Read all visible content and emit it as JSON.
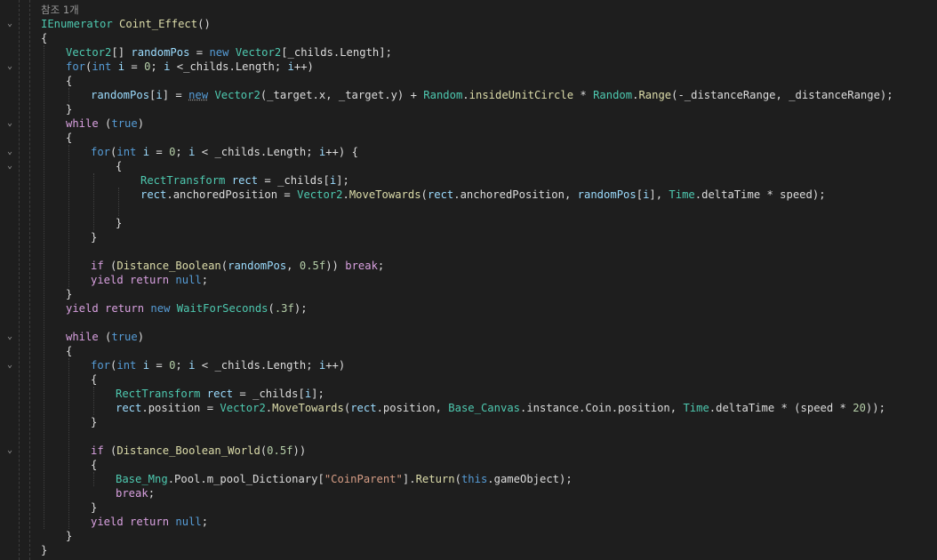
{
  "editor": {
    "codelens": "참조 1개",
    "lines": [
      [
        [
          "t",
          "IEnumerator"
        ],
        [
          "m",
          " Coint_Effect"
        ],
        [
          "p",
          "()"
        ]
      ],
      [
        [
          "p",
          "{"
        ]
      ],
      [
        [
          "t",
          "Vector2"
        ],
        [
          "p",
          "[] "
        ],
        [
          "v",
          "randomPos"
        ],
        [
          "p",
          " = "
        ],
        [
          "k",
          "new"
        ],
        [
          "p",
          " "
        ],
        [
          "t",
          "Vector2"
        ],
        [
          "p",
          "[_childs.Length];"
        ]
      ],
      [
        [
          "k",
          "for"
        ],
        [
          "p",
          "("
        ],
        [
          "k",
          "int"
        ],
        [
          "p",
          " "
        ],
        [
          "v",
          "i"
        ],
        [
          "p",
          " = "
        ],
        [
          "n",
          "0"
        ],
        [
          "p",
          "; "
        ],
        [
          "v",
          "i"
        ],
        [
          "p",
          " <_childs.Length; "
        ],
        [
          "v",
          "i"
        ],
        [
          "p",
          "++)"
        ]
      ],
      [
        [
          "p",
          "{"
        ]
      ],
      [
        [
          "v",
          "randomPos"
        ],
        [
          "p",
          "["
        ],
        [
          "v",
          "i"
        ],
        [
          "p",
          "] = "
        ],
        [
          "kq",
          "new"
        ],
        [
          "p",
          " "
        ],
        [
          "t",
          "Vector2"
        ],
        [
          "p",
          "(_target.x, _target.y) + "
        ],
        [
          "t",
          "Random"
        ],
        [
          "p",
          "."
        ],
        [
          "m",
          "insideUnitCircle"
        ],
        [
          "p",
          " * "
        ],
        [
          "t",
          "Random"
        ],
        [
          "p",
          "."
        ],
        [
          "m",
          "Range"
        ],
        [
          "p",
          "(-_distanceRange, _distanceRange);"
        ]
      ],
      [
        [
          "p",
          "}"
        ]
      ],
      [
        [
          "c",
          "while"
        ],
        [
          "p",
          " ("
        ],
        [
          "k",
          "true"
        ],
        [
          "p",
          ")"
        ]
      ],
      [
        [
          "p",
          "{"
        ]
      ],
      [
        [
          "k",
          "for"
        ],
        [
          "p",
          "("
        ],
        [
          "k",
          "int"
        ],
        [
          "p",
          " "
        ],
        [
          "v",
          "i"
        ],
        [
          "p",
          " = "
        ],
        [
          "n",
          "0"
        ],
        [
          "p",
          "; "
        ],
        [
          "v",
          "i"
        ],
        [
          "p",
          " < _childs.Length; "
        ],
        [
          "v",
          "i"
        ],
        [
          "p",
          "++) {"
        ]
      ],
      [
        [
          "p",
          "{"
        ]
      ],
      [
        [
          "t",
          "RectTransform"
        ],
        [
          "p",
          " "
        ],
        [
          "v",
          "rect"
        ],
        [
          "p",
          " = _childs["
        ],
        [
          "v",
          "i"
        ],
        [
          "p",
          "];"
        ]
      ],
      [
        [
          "v",
          "rect"
        ],
        [
          "p",
          ".anchoredPosition = "
        ],
        [
          "t",
          "Vector2"
        ],
        [
          "p",
          "."
        ],
        [
          "m",
          "MoveTowards"
        ],
        [
          "p",
          "("
        ],
        [
          "v",
          "rect"
        ],
        [
          "p",
          ".anchoredPosition, "
        ],
        [
          "v",
          "randomPos"
        ],
        [
          "p",
          "["
        ],
        [
          "v",
          "i"
        ],
        [
          "p",
          "], "
        ],
        [
          "t",
          "Time"
        ],
        [
          "p",
          ".deltaTime * speed);"
        ]
      ],
      [],
      [
        [
          "p",
          "}"
        ]
      ],
      [
        [
          "p",
          "}"
        ]
      ],
      [],
      [
        [
          "c",
          "if"
        ],
        [
          "p",
          " ("
        ],
        [
          "m",
          "Distance_Boolean"
        ],
        [
          "p",
          "("
        ],
        [
          "v",
          "randomPos"
        ],
        [
          "p",
          ", "
        ],
        [
          "n",
          "0.5f"
        ],
        [
          "p",
          ")) "
        ],
        [
          "c",
          "break"
        ],
        [
          "p",
          ";"
        ]
      ],
      [
        [
          "c",
          "yield"
        ],
        [
          "p",
          " "
        ],
        [
          "c",
          "return"
        ],
        [
          "p",
          " "
        ],
        [
          "k",
          "null"
        ],
        [
          "p",
          ";"
        ]
      ],
      [
        [
          "p",
          "}"
        ]
      ],
      [
        [
          "c",
          "yield"
        ],
        [
          "p",
          " "
        ],
        [
          "c",
          "return"
        ],
        [
          "p",
          " "
        ],
        [
          "k",
          "new"
        ],
        [
          "p",
          " "
        ],
        [
          "t",
          "WaitForSeconds"
        ],
        [
          "p",
          "("
        ],
        [
          "n",
          ".3f"
        ],
        [
          "p",
          ");"
        ]
      ],
      [],
      [
        [
          "c",
          "while"
        ],
        [
          "p",
          " ("
        ],
        [
          "k",
          "true"
        ],
        [
          "p",
          ")"
        ]
      ],
      [
        [
          "p",
          "{"
        ]
      ],
      [
        [
          "k",
          "for"
        ],
        [
          "p",
          "("
        ],
        [
          "k",
          "int"
        ],
        [
          "p",
          " "
        ],
        [
          "v",
          "i"
        ],
        [
          "p",
          " = "
        ],
        [
          "n",
          "0"
        ],
        [
          "p",
          "; "
        ],
        [
          "v",
          "i"
        ],
        [
          "p",
          " < _childs.Length; "
        ],
        [
          "v",
          "i"
        ],
        [
          "p",
          "++)"
        ]
      ],
      [
        [
          "p",
          "{"
        ]
      ],
      [
        [
          "t",
          "RectTransform"
        ],
        [
          "p",
          " "
        ],
        [
          "v",
          "rect"
        ],
        [
          "p",
          " = _childs["
        ],
        [
          "v",
          "i"
        ],
        [
          "p",
          "];"
        ]
      ],
      [
        [
          "v",
          "rect"
        ],
        [
          "p",
          ".position = "
        ],
        [
          "t",
          "Vector2"
        ],
        [
          "p",
          "."
        ],
        [
          "m",
          "MoveTowards"
        ],
        [
          "p",
          "("
        ],
        [
          "v",
          "rect"
        ],
        [
          "p",
          ".position, "
        ],
        [
          "t",
          "Base_Canvas"
        ],
        [
          "p",
          ".instance.Coin.position, "
        ],
        [
          "t",
          "Time"
        ],
        [
          "p",
          ".deltaTime * (speed * "
        ],
        [
          "n",
          "20"
        ],
        [
          "p",
          "));"
        ]
      ],
      [
        [
          "p",
          "}"
        ]
      ],
      [],
      [
        [
          "c",
          "if"
        ],
        [
          "p",
          " ("
        ],
        [
          "m",
          "Distance_Boolean_World"
        ],
        [
          "p",
          "("
        ],
        [
          "n",
          "0.5f"
        ],
        [
          "p",
          "))"
        ]
      ],
      [
        [
          "p",
          "{"
        ]
      ],
      [
        [
          "t",
          "Base_Mng"
        ],
        [
          "p",
          ".Pool.m_pool_Dictionary["
        ],
        [
          "s",
          "\"CoinParent\""
        ],
        [
          "p",
          "]."
        ],
        [
          "m",
          "Return"
        ],
        [
          "p",
          "("
        ],
        [
          "k",
          "this"
        ],
        [
          "p",
          ".gameObject);"
        ]
      ],
      [
        [
          "c",
          "break"
        ],
        [
          "p",
          ";"
        ]
      ],
      [
        [
          "p",
          "}"
        ]
      ],
      [
        [
          "c",
          "yield"
        ],
        [
          "p",
          " "
        ],
        [
          "c",
          "return"
        ],
        [
          "p",
          " "
        ],
        [
          "k",
          "null"
        ],
        [
          "p",
          ";"
        ]
      ],
      [
        [
          "p",
          "}"
        ]
      ],
      [
        [
          "p",
          "}"
        ]
      ]
    ]
  },
  "colors": {
    "background": "#1e1e1e",
    "keyword": "#569cd6",
    "control": "#d8a0df",
    "type": "#4ec9b0",
    "method": "#dcdcaa",
    "variable": "#9cdcfe",
    "number": "#b5cea8",
    "string": "#d69d85",
    "plain": "#dcdcdc"
  }
}
